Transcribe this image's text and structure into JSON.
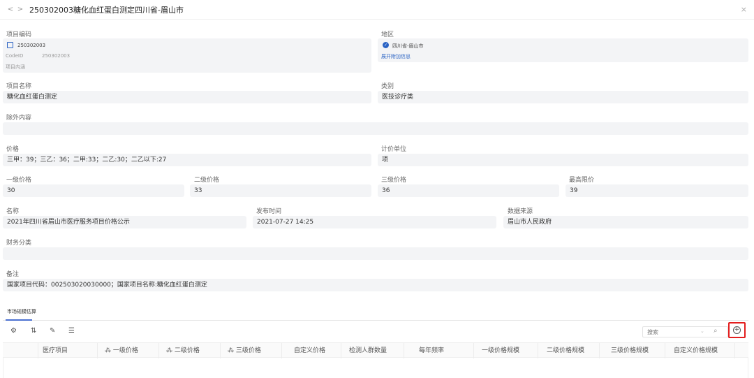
{
  "header": {
    "back": "<",
    "forward": ">",
    "title": "250302003糖化血红蛋白测定四川省-眉山市",
    "close": "×"
  },
  "fields": {
    "code": {
      "label": "项目编码",
      "value": "250302003",
      "codeid_label": "CodeID",
      "codeid_value": "250302003",
      "connotation": "项目内涵"
    },
    "region": {
      "label": "地区",
      "value": "四川省-眉山市",
      "expand": "展开附加信息"
    },
    "name": {
      "label": "项目名称",
      "value": "糖化血红蛋白测定"
    },
    "category": {
      "label": "类别",
      "value": "医技诊疗类"
    },
    "exclusion": {
      "label": "除外内容",
      "value": ""
    },
    "price": {
      "label": "价格",
      "value": "三甲：39；三乙：36；二甲:33；二乙:30；二乙以下:27"
    },
    "unit": {
      "label": "计价单位",
      "value": "项"
    },
    "price1": {
      "label": "一级价格",
      "value": "30"
    },
    "price2": {
      "label": "二级价格",
      "value": "33"
    },
    "price3": {
      "label": "三级价格",
      "value": "36"
    },
    "price_max": {
      "label": "最高限价",
      "value": "39"
    },
    "source_name": {
      "label": "名称",
      "value": "2021年四川省眉山市医疗服务项目价格公示"
    },
    "publish_time": {
      "label": "发布时间",
      "value": "2021-07-27 14:25"
    },
    "data_source": {
      "label": "数据来源",
      "value": "眉山市人民政府"
    },
    "finance": {
      "label": "财务分类",
      "value": ""
    },
    "remark": {
      "label": "备注",
      "value": "国家项目代码：002503020030000；国家项目名称:糖化血红蛋白测定"
    }
  },
  "tabs": [
    {
      "label": "市场规模估算",
      "active": true
    }
  ],
  "toolbar": {
    "tools": [
      {
        "name": "settings-icon",
        "glyph": "⚙"
      },
      {
        "name": "sort-icon",
        "glyph": "⇅"
      },
      {
        "name": "pin-icon",
        "glyph": "✎"
      },
      {
        "name": "list-icon",
        "glyph": "☰"
      }
    ],
    "search_placeholder": "搜索",
    "add_glyph": "+"
  },
  "table": {
    "columns": [
      "医疗项目",
      "一级价格",
      "二级价格",
      "三级价格",
      "自定义价格",
      "检测人群数量",
      "每年频率",
      "一级价格规模",
      "二级价格规模",
      "三级价格规模",
      "自定义价格规模"
    ],
    "rows": []
  },
  "colors": {
    "accent": "#2a63c4",
    "highlight": "#e31e1e",
    "field_bg": "#f3f4f6"
  }
}
